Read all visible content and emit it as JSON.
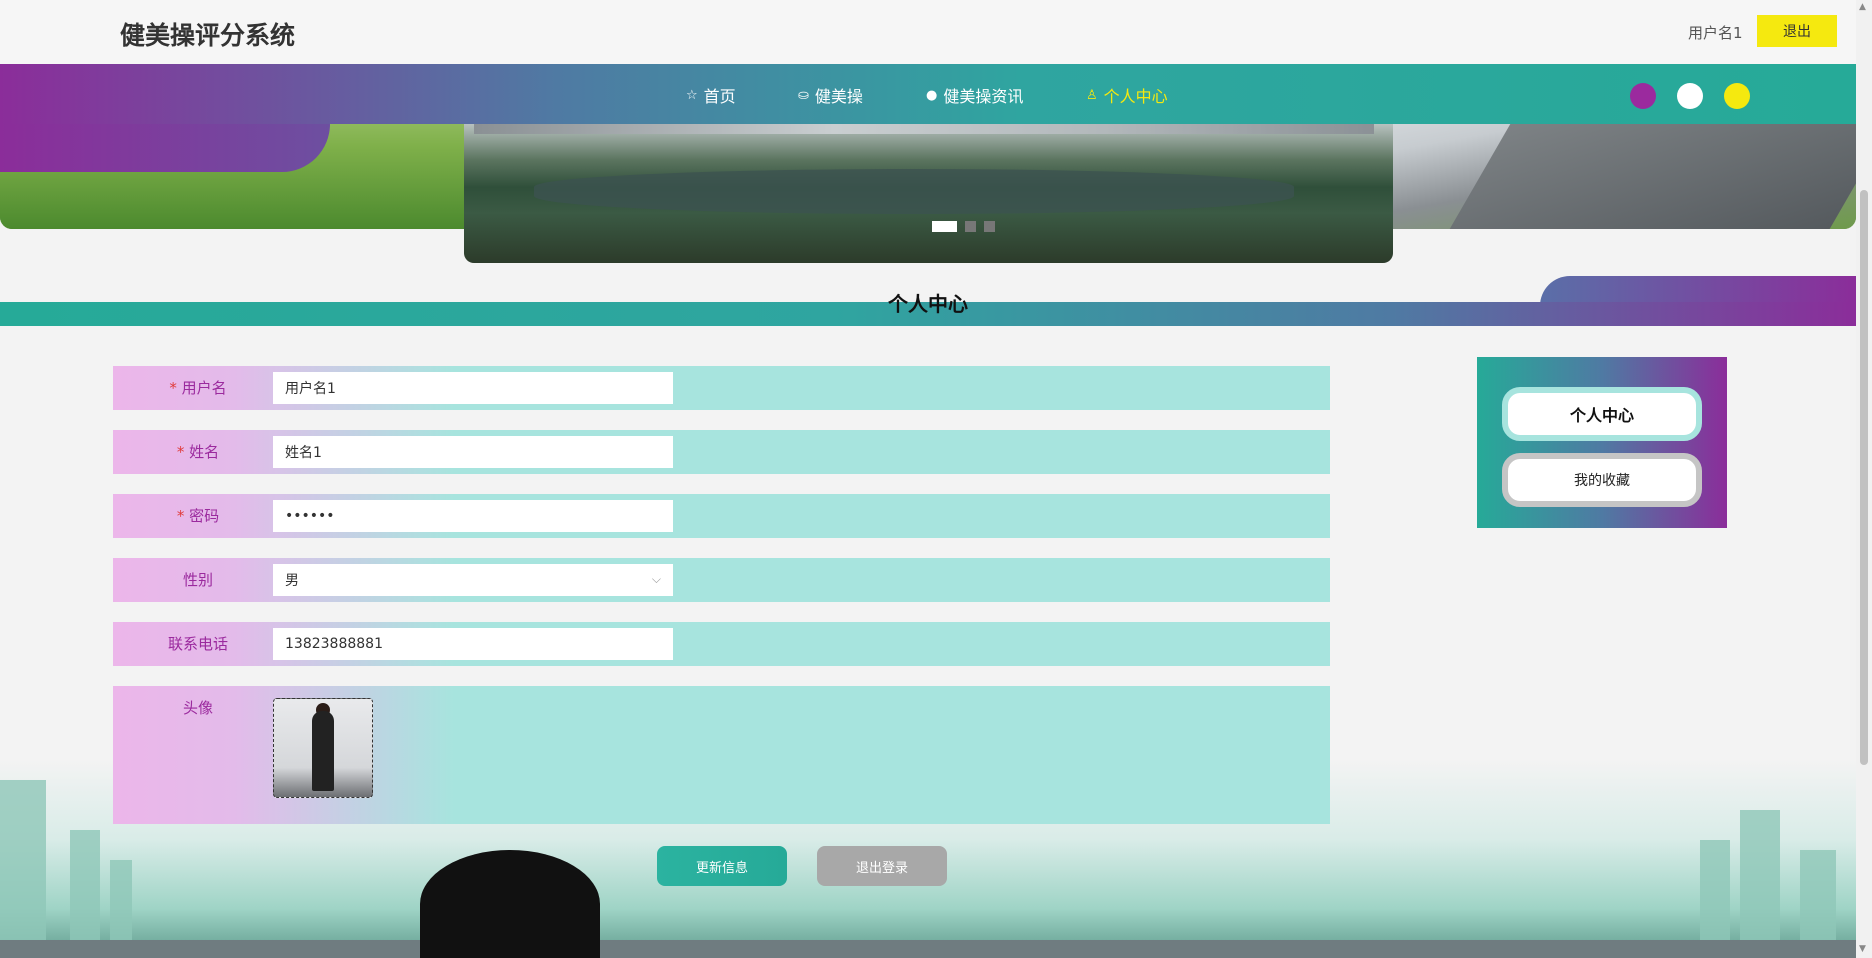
{
  "header": {
    "site_title": "健美操评分系统",
    "username": "用户名1",
    "logout_label": "退出"
  },
  "nav": {
    "items": [
      {
        "label": "首页",
        "icon": "star-icon"
      },
      {
        "label": "健美操",
        "icon": "bag-icon"
      },
      {
        "label": "健美操资讯",
        "icon": "info-icon"
      },
      {
        "label": "个人中心",
        "icon": "user-icon",
        "active": true
      }
    ],
    "theme_colors": [
      "#9b2a9e",
      "#ffffff",
      "#f5e90f"
    ]
  },
  "carousel": {
    "slide_count": 3,
    "active_index": 0
  },
  "section_title": "个人中心",
  "form": {
    "username": {
      "label": "用户名",
      "required": "*",
      "value": "用户名1"
    },
    "name": {
      "label": "姓名",
      "required": "*",
      "value": "姓名1"
    },
    "password": {
      "label": "密码",
      "required": "*",
      "value": "••••••"
    },
    "gender": {
      "label": "性别",
      "value": "男"
    },
    "phone": {
      "label": "联系电话",
      "value": "13823888881"
    },
    "avatar": {
      "label": "头像"
    }
  },
  "buttons": {
    "update_label": "更新信息",
    "logout_label": "退出登录"
  },
  "side_menu": {
    "items": [
      "个人中心",
      "我的收藏"
    ]
  },
  "colors": {
    "accent_teal": "#26aa98",
    "accent_purple": "#8b2d9a",
    "accent_yellow": "#f5e90f"
  }
}
